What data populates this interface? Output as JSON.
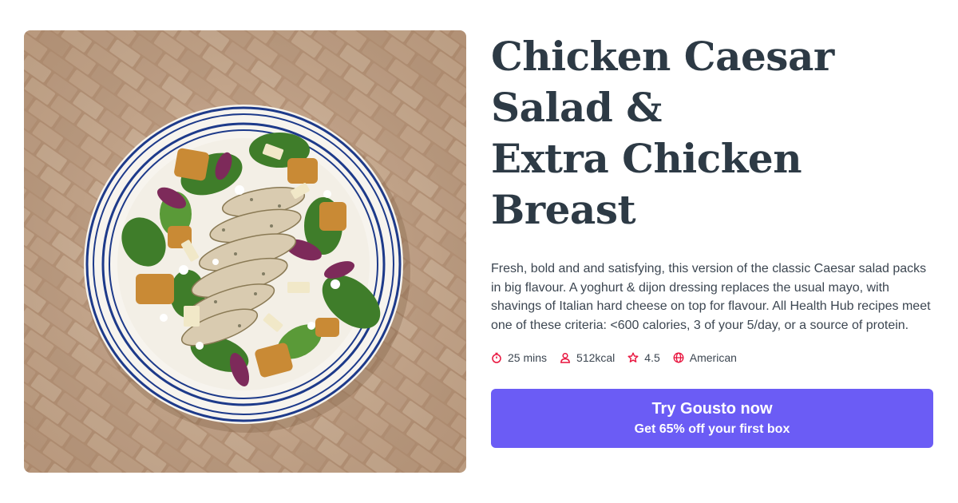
{
  "recipe": {
    "title_line1": "Chicken Caesar Salad &",
    "title_line2": "Extra Chicken Breast",
    "description": "Fresh, bold and and satisfying, this version of the classic Caesar salad packs in big flavour. A yoghurt & dijon dressing replaces the usual mayo, with shavings of Italian hard cheese on top for flavour. All Health Hub recipes meet one of these criteria: <600 calories, 3 of your 5/day, or a source of protein.",
    "meta": {
      "time": "25 mins",
      "calories": "512kcal",
      "rating": "4.5",
      "cuisine": "American"
    },
    "image_icon": "salad-plate-photo"
  },
  "cta": {
    "title": "Try Gousto now",
    "subtitle": "Get 65% off your first box"
  },
  "colors": {
    "accent": "#6b5cf5",
    "meta_icon": "#e8123c",
    "title": "#2d3a45"
  }
}
